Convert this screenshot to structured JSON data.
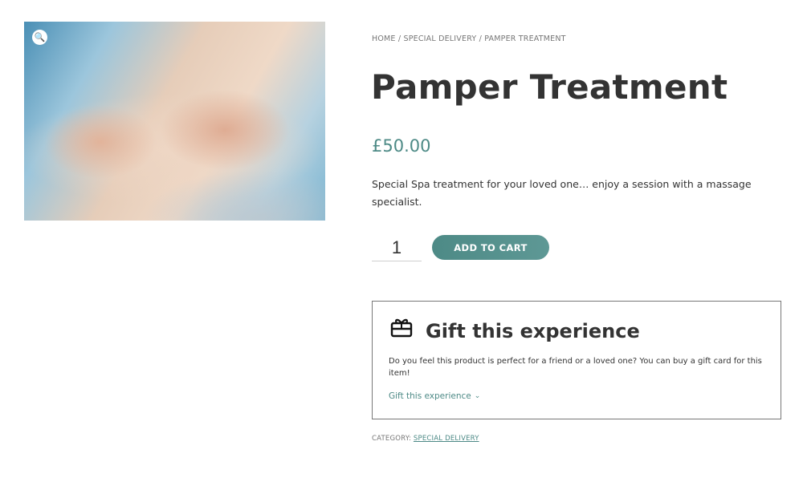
{
  "breadcrumb": {
    "home": "HOME",
    "sep1": " / ",
    "special_delivery": "SPECIAL DELIVERY",
    "sep2": " / ",
    "current": "PAMPER TREATMENT"
  },
  "product": {
    "title": "Pamper Treatment",
    "price": "£50.00",
    "description": "Special Spa treatment for your loved one… enjoy a session with a massage specialist.",
    "quantity": "1",
    "add_to_cart_label": "ADD TO CART",
    "zoom_icon": "magnifier-icon"
  },
  "gift": {
    "icon": "gift-card-icon",
    "title": "Gift this experience",
    "text": "Do you feel this product is perfect for a friend or a loved one? You can buy a gift card for this item!",
    "link_label": "Gift this experience",
    "link_icon": "chevron-down-icon"
  },
  "category": {
    "label": "CATEGORY: ",
    "value": "SPECIAL DELIVERY"
  },
  "colors": {
    "accent": "#4d8a86",
    "text": "#333333",
    "muted": "#777777"
  }
}
